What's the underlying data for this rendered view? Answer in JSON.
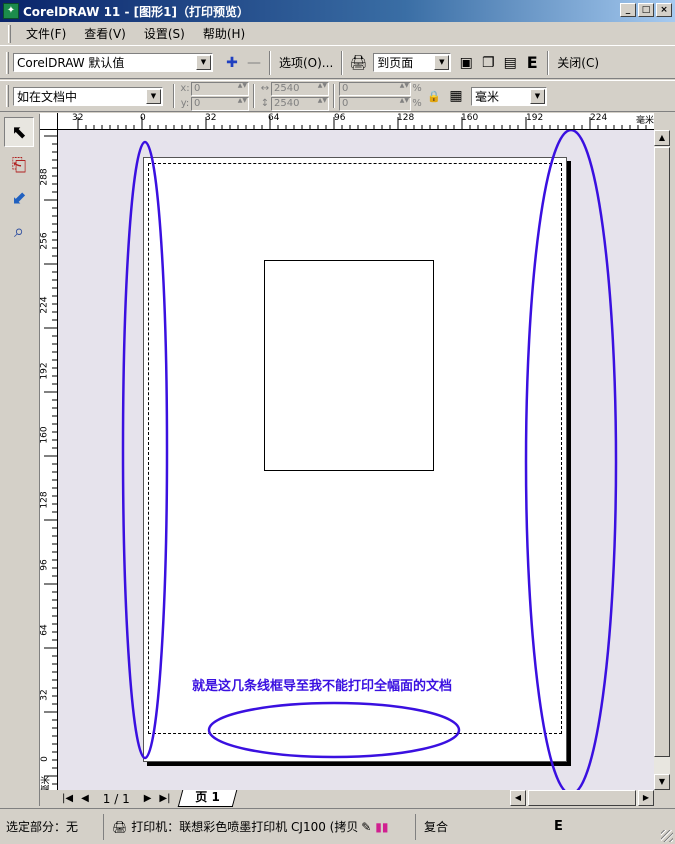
{
  "window": {
    "title": "CorelDRAW 11 - [图形1]（打印预览）",
    "app_icon": "coreldraw-icon",
    "controls": [
      "_",
      "□",
      "×"
    ]
  },
  "menu": {
    "items": [
      "文件(F)",
      "查看(V)",
      "设置(S)",
      "帮助(H)"
    ]
  },
  "toolbar1": {
    "style_value": "CorelDRAW 默认值",
    "options_label": "选项(O)...",
    "fit_value": "到页面",
    "close_label": "关闭(C)"
  },
  "toolbar2": {
    "position_value": "如在文档中",
    "x_label": "x:",
    "y_label": "y:",
    "x_value": "0",
    "y_value": "0",
    "w_value": "2540",
    "h_value": "2540",
    "sx_value": "0",
    "sy_value": "0",
    "unit_value": "毫米"
  },
  "ruler": {
    "unit": "毫米",
    "h_ticks": [
      "32",
      "0",
      "32",
      "64",
      "96",
      "128",
      "160",
      "192",
      "224"
    ],
    "v_ticks": [
      "288",
      "256",
      "224",
      "192",
      "160",
      "128",
      "96",
      "64",
      "32",
      "0"
    ]
  },
  "page_nav": {
    "page_count": "1 / 1",
    "tab_label": "页 1"
  },
  "annotation": {
    "text": "就是这几条线框导至我不能打印全幅面的文档",
    "color": "#3a10e0"
  },
  "status": {
    "selection": "选定部分：无",
    "printer": "打印机：联想彩色喷墨打印机 CJ100 (拷贝",
    "mode": "复合"
  },
  "colors": {
    "title_blue": "#0a246a",
    "canvas_bg": "#e6e3ec",
    "annotation": "#3a10e0"
  }
}
